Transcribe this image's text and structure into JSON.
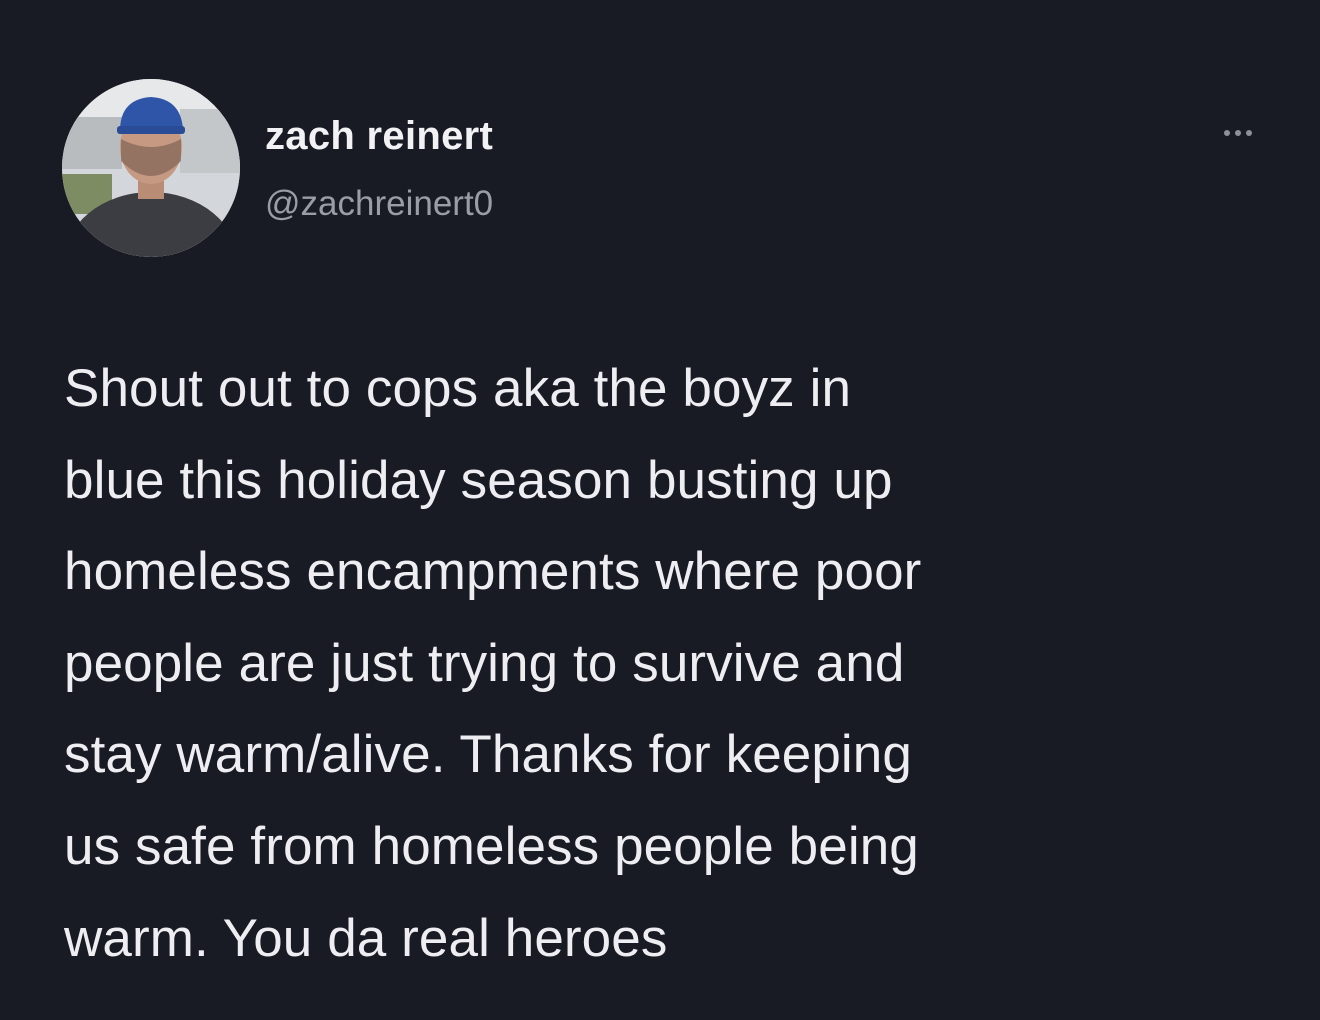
{
  "tweet": {
    "author": {
      "display_name": "zach reinert",
      "handle": "@zachreinert0"
    },
    "more_icon": "more-horizontal-icon",
    "text_lines": [
      "Shout out to cops aka the boyz in",
      "blue this holiday season busting up",
      "homeless encampments where poor",
      "people are just trying to survive and",
      "stay warm/alive. Thanks for keeping",
      "us safe from homeless people being",
      "warm. You da real heroes"
    ]
  },
  "colors": {
    "background": "#181a24",
    "text": "#eeeef2",
    "handle": "#9a9ca6"
  }
}
